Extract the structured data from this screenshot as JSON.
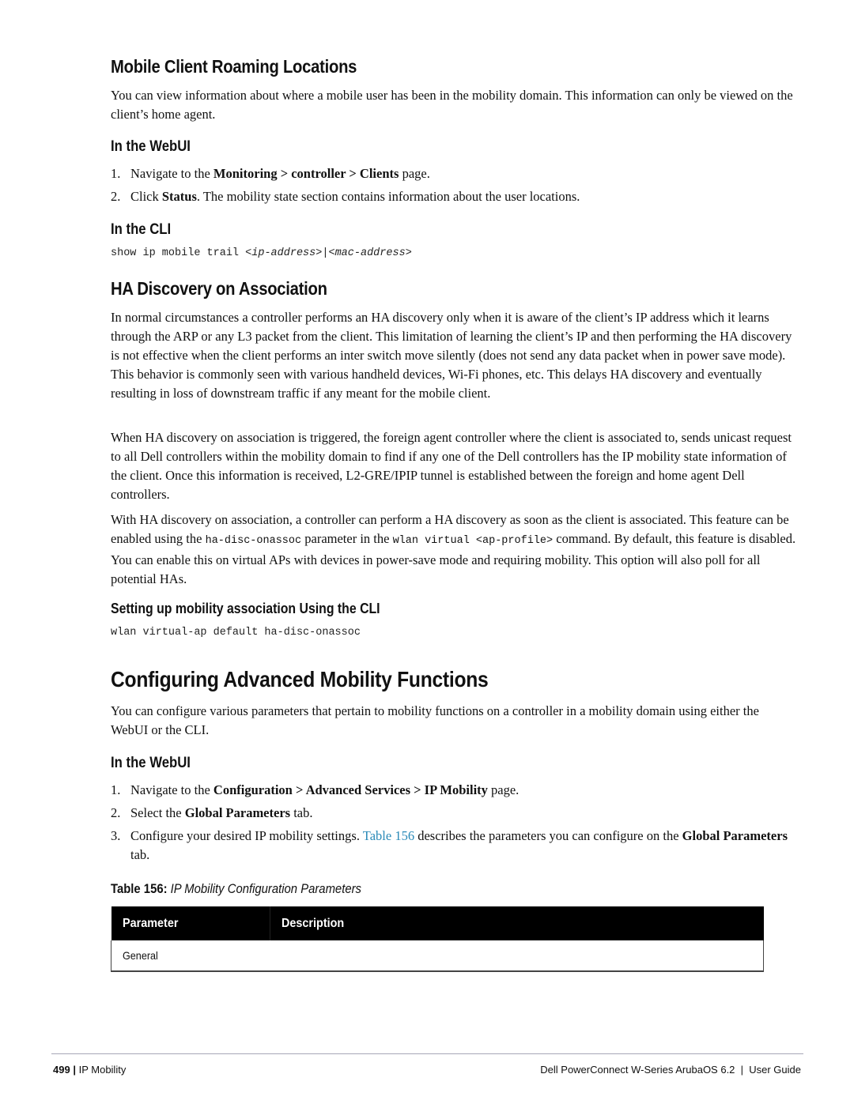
{
  "sections": {
    "roaming": {
      "heading": "Mobile Client Roaming Locations",
      "intro": "You can view information about where a mobile user has been in the mobility domain. This information can only be viewed on the client’s home agent.",
      "webui_heading": "In the WebUI",
      "steps": [
        {
          "num": "1.",
          "pre": "Navigate to the ",
          "bold": "Monitoring > controller > Clients",
          "post": " page."
        },
        {
          "num": "2.",
          "pre": "Click ",
          "bold": "Status",
          "post": ". The mobility state section contains information about the user locations."
        }
      ],
      "cli_heading": "In the CLI",
      "cli_cmd": "show ip mobile trail ",
      "cli_arg1": "ip-address",
      "cli_arg2": "mac-address"
    },
    "ha_discovery": {
      "heading": "HA Discovery on Association",
      "para1": "In normal circumstances a controller performs an HA discovery only when it is aware of the client’s IP address which it learns through the ARP or any L3 packet from the client. This limitation of learning the client’s IP and then performing the HA discovery is not effective when the client performs an inter switch move silently (does not send any data packet when in power save mode). This behavior is commonly seen with various handheld devices, Wi-Fi phones, etc. This delays HA discovery and eventually resulting in loss of downstream traffic if any meant for the mobile client.",
      "para2": "When HA discovery on association is triggered, the foreign agent controller where the client is associated to, sends unicast request to all Dell controllers within the mobility domain to find if any one of the Dell controllers has the IP mobility state information of the client. Once this information is received, L2-GRE/IPIP tunnel is established between the foreign and home agent Dell controllers.",
      "para3_a": "With HA discovery on association, a controller can perform a HA discovery as soon as the client is associated. This feature can be enabled using the ",
      "para3_code1": "ha-disc-onassoc",
      "para3_b": " parameter in the ",
      "para3_code2": "wlan virtual <ap-profile>",
      "para3_c": " command. By default, this feature is disabled. You can enable this on virtual APs with devices in power-save mode and requiring mobility. This option will also poll for all potential HAs.",
      "cli_heading": "Setting up mobility association Using the CLI",
      "cli_cmd": "wlan virtual-ap default ha-disc-onassoc"
    },
    "advanced": {
      "heading": "Configuring Advanced Mobility Functions",
      "intro": "You can configure various parameters that pertain to mobility functions on a controller in a mobility domain using either the WebUI or the CLI.",
      "webui_heading": "In the WebUI",
      "step1": {
        "num": "1.",
        "pre": "Navigate to the ",
        "bold": "Configuration > Advanced Services > IP Mobility",
        "post": " page."
      },
      "step2": {
        "num": "2.",
        "pre": "Select the ",
        "bold": "Global Parameters",
        "post": " tab."
      },
      "step3": {
        "num": "3.",
        "pre": "Configure your desired IP mobility settings. ",
        "link": "Table 156",
        "mid": " describes the parameters you can configure on the ",
        "bold": "Global Parameters",
        "post": " tab."
      }
    }
  },
  "table": {
    "caption_label": "Table 156:",
    "caption_title": "IP Mobility Configuration Parameters",
    "headers": [
      "Parameter",
      "Description"
    ],
    "rows": [
      [
        "General",
        ""
      ]
    ]
  },
  "footer": {
    "page_number": "499",
    "separator": "|",
    "chapter": "IP Mobility",
    "guide_title": "Dell PowerConnect W-Series ArubaOS 6.2  |  User Guide"
  },
  "colors": {
    "link": "#2a8ab8",
    "table_header_bg": "#000000",
    "footer_rule": "#a6a6b6"
  }
}
